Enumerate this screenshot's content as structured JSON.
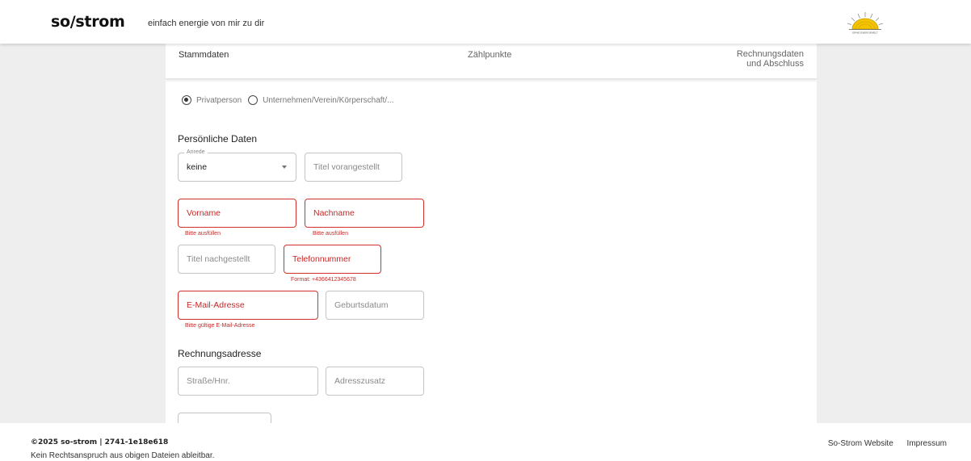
{
  "header": {
    "logo": "so/strom",
    "slogan": "einfach energie von mir zu dir",
    "sun_logo_caption": "ERNIE ENERGIEWELT"
  },
  "stepper": {
    "steps": [
      {
        "label": "Stammdaten"
      },
      {
        "label": "Zählpunkte"
      },
      {
        "label": "Rechnungsdaten\nund Abschluss"
      }
    ]
  },
  "customer_type": {
    "options": [
      {
        "label": "Privatperson",
        "checked": true
      },
      {
        "label": "Unternehmen/Verein/Körperschaft/...",
        "checked": false
      }
    ]
  },
  "personal": {
    "title": "Persönliche Daten",
    "salutation": {
      "legend": "Anrede",
      "value": "keine"
    },
    "title_prefix": {
      "placeholder": "Titel vorangestellt"
    },
    "first_name": {
      "placeholder": "Vorname",
      "helper": "Bitte ausfüllen"
    },
    "last_name": {
      "placeholder": "Nachname",
      "helper": "Bitte ausfüllen"
    },
    "title_suffix": {
      "placeholder": "Titel nachgestellt"
    },
    "phone": {
      "placeholder": "Telefonnummer",
      "helper": "Format: +4366412345678"
    },
    "email": {
      "placeholder": "E-Mail-Adresse",
      "helper": "Bitte gültige E-Mail-Adresse"
    },
    "birthdate": {
      "placeholder": "Geburtsdatum"
    }
  },
  "billing": {
    "title": "Rechnungsadresse",
    "street": {
      "placeholder": "Straße/Hnr."
    },
    "address_extra": {
      "placeholder": "Adresszusatz"
    }
  },
  "footer": {
    "copyright": "©2025 so-strom | 2741-1e18e618",
    "disclaimer": "Kein Rechtsanspruch aus obigen Dateien ableitbar.",
    "links": [
      "So-Strom Website",
      "Impressum"
    ]
  },
  "colors": {
    "error": "#d32f2f",
    "sun": "#f2c500"
  }
}
